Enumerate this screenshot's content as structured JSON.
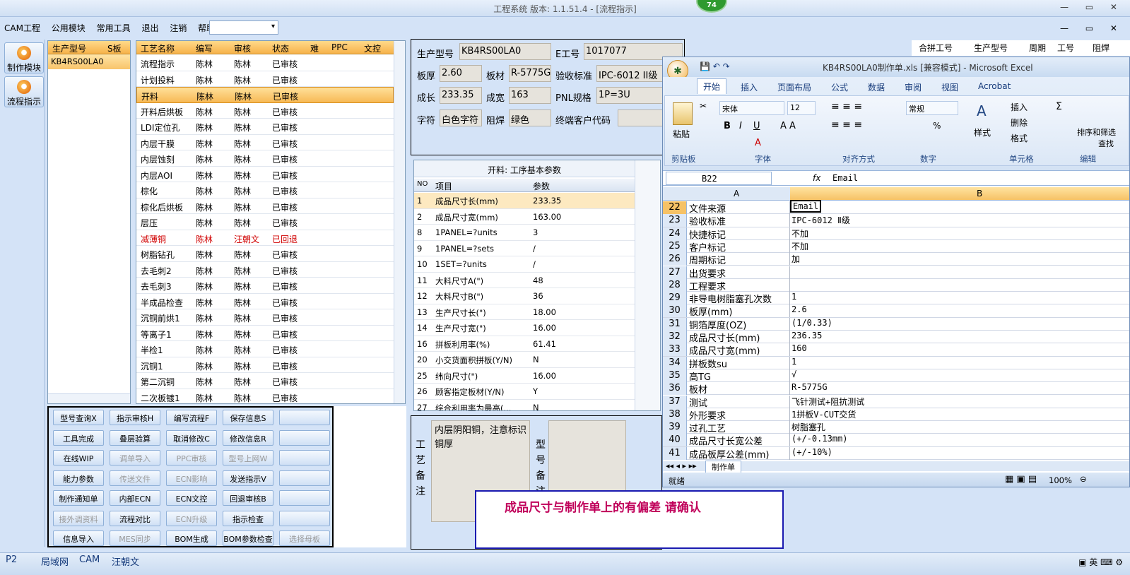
{
  "window": {
    "title": "工程系统   版本: 1.1.51.4 - [流程指示]",
    "badge": "74"
  },
  "menu": [
    "CAM工程",
    "公用模块",
    "常用工具",
    "退出",
    "注销",
    "帮助"
  ],
  "nav": [
    {
      "label": "制作模块"
    },
    {
      "label": "流程指示"
    }
  ],
  "prodlist": {
    "headers": [
      "生产型号",
      "S板"
    ],
    "rows": [
      "KB4RS00LA0"
    ]
  },
  "flow": {
    "headers": [
      "工艺名称",
      "编写",
      "审核",
      "状态",
      "难",
      "PPC",
      "文控"
    ],
    "rows": [
      {
        "name": "流程指示",
        "writer": "陈林",
        "reviewer": "陈林",
        "status": "已审核"
      },
      {
        "name": "计划投料",
        "writer": "陈林",
        "reviewer": "陈林",
        "status": "已审核"
      },
      {
        "name": "开料",
        "writer": "陈林",
        "reviewer": "陈林",
        "status": "已审核"
      },
      {
        "name": "开料后烘板",
        "writer": "陈林",
        "reviewer": "陈林",
        "status": "已审核"
      },
      {
        "name": "LDI定位孔",
        "writer": "陈林",
        "reviewer": "陈林",
        "status": "已审核"
      },
      {
        "name": "内层干膜",
        "writer": "陈林",
        "reviewer": "陈林",
        "status": "已审核"
      },
      {
        "name": "内层蚀刻",
        "writer": "陈林",
        "reviewer": "陈林",
        "status": "已审核"
      },
      {
        "name": "内层AOI",
        "writer": "陈林",
        "reviewer": "陈林",
        "status": "已审核"
      },
      {
        "name": "棕化",
        "writer": "陈林",
        "reviewer": "陈林",
        "status": "已审核"
      },
      {
        "name": "棕化后烘板",
        "writer": "陈林",
        "reviewer": "陈林",
        "status": "已审核"
      },
      {
        "name": "层压",
        "writer": "陈林",
        "reviewer": "陈林",
        "status": "已审核"
      },
      {
        "name": "减薄铜",
        "writer": "陈林",
        "reviewer": "汪朝文",
        "status": "已回退"
      },
      {
        "name": "树脂钻孔",
        "writer": "陈林",
        "reviewer": "陈林",
        "status": "已审核"
      },
      {
        "name": "去毛刺2",
        "writer": "陈林",
        "reviewer": "陈林",
        "status": "已审核"
      },
      {
        "name": "去毛刺3",
        "writer": "陈林",
        "reviewer": "陈林",
        "status": "已审核"
      },
      {
        "name": "半成品检查",
        "writer": "陈林",
        "reviewer": "陈林",
        "status": "已审核"
      },
      {
        "name": "沉铜前烘1",
        "writer": "陈林",
        "reviewer": "陈林",
        "status": "已审核"
      },
      {
        "name": "等离子1",
        "writer": "陈林",
        "reviewer": "陈林",
        "status": "已审核"
      },
      {
        "name": "半检1",
        "writer": "陈林",
        "reviewer": "陈林",
        "status": "已审核"
      },
      {
        "name": "沉铜1",
        "writer": "陈林",
        "reviewer": "陈林",
        "status": "已审核"
      },
      {
        "name": "第二沉铜",
        "writer": "陈林",
        "reviewer": "陈林",
        "status": "已审核"
      },
      {
        "name": "二次板镀1",
        "writer": "陈林",
        "reviewer": "陈林",
        "status": "已审核"
      }
    ]
  },
  "buttons": [
    [
      "型号查询X",
      "指示审核H",
      "编写流程F",
      "保存信息S",
      ""
    ],
    [
      "工具完成",
      "叠层验算",
      "取消修改C",
      "修改信息R",
      ""
    ],
    [
      "在线WIP",
      "调单导入",
      "PPC审核",
      "型号上网W",
      ""
    ],
    [
      "能力参数",
      "传送文件",
      "ECN影响",
      "发送指示V",
      ""
    ],
    [
      "制作通知单",
      "内部ECN",
      "ECN文控",
      "回退审核B",
      ""
    ],
    [
      "接外调资料",
      "流程对比",
      "ECN升级",
      "指示检查",
      ""
    ],
    [
      "信息导入",
      "MES同步",
      "BOM生成",
      "BOM参数检查",
      "选择母板"
    ]
  ],
  "info": {
    "prod_label": "生产型号",
    "prod": "KB4RS00LA0",
    "e_label": "E工号",
    "e": "1017077",
    "thick_label": "板厚",
    "thick": "2.60",
    "mat_label": "板材",
    "mat": "R-5775G",
    "std_label": "验收标准",
    "std": "IPC-6012 II级",
    "len_label": "成长",
    "len": "233.35",
    "wid_label": "成宽",
    "wid": "163",
    "pnl_label": "PNL规格",
    "pnl": "1P=3U",
    "char_label": "字符",
    "char": "白色字符",
    "mask_label": "阻焊",
    "mask": "绿色",
    "cust_label": "终端客户代码",
    "cust": ""
  },
  "params": {
    "title": "开料: 工序基本参数",
    "headers": [
      "NO",
      "项目",
      "参数"
    ],
    "rows": [
      {
        "no": "1",
        "item": "成品尺寸长(mm)",
        "val": "233.35"
      },
      {
        "no": "2",
        "item": "成品尺寸宽(mm)",
        "val": "163.00"
      },
      {
        "no": "8",
        "item": "1PANEL=?units",
        "val": "3"
      },
      {
        "no": "9",
        "item": "1PANEL=?sets",
        "val": "/"
      },
      {
        "no": "10",
        "item": "1SET=?units",
        "val": "/"
      },
      {
        "no": "11",
        "item": "大料尺寸A(\")",
        "val": "48"
      },
      {
        "no": "12",
        "item": "大料尺寸B(\")",
        "val": "36"
      },
      {
        "no": "13",
        "item": "生产尺寸长(\")",
        "val": "18.00"
      },
      {
        "no": "14",
        "item": "生产尺寸宽(\")",
        "val": "16.00"
      },
      {
        "no": "16",
        "item": "拼板利用率(%)",
        "val": "61.41"
      },
      {
        "no": "20",
        "item": "小交货面积拼板(Y/N)",
        "val": "N"
      },
      {
        "no": "25",
        "item": "纬向尺寸(\")",
        "val": "16.00"
      },
      {
        "no": "26",
        "item": "顾客指定板材(Y/N)",
        "val": "Y"
      },
      {
        "no": "27",
        "item": "综合利用率为最高(...",
        "val": "N"
      }
    ]
  },
  "remarks": {
    "craft_label": "工艺备注",
    "craft_text": "内层阴阳铜，注意标识铜厚",
    "model_label": "型号备注"
  },
  "rightlist": {
    "headers": [
      "合拼工号",
      "生产型号",
      "周期",
      "工号",
      "阻焊"
    ]
  },
  "excel": {
    "title": "KB4RS00LA0制作单.xls  [兼容模式] - Microsoft Excel",
    "tabs": [
      "开始",
      "插入",
      "页面布局",
      "公式",
      "数据",
      "审阅",
      "视图",
      "Acrobat"
    ],
    "font": "宋体",
    "size": "12",
    "numfmt": "常规",
    "groups": [
      "剪贴板",
      "字体",
      "对齐方式",
      "数字",
      "单元格",
      "编辑"
    ],
    "ribbon": {
      "paste": "粘贴",
      "style": "样式",
      "insert": "插入",
      "delete": "删除",
      "format": "格式",
      "sort": "排序和筛选",
      "find": "查找"
    },
    "cellref": "B22",
    "formula": "Email",
    "cols": [
      "A",
      "B"
    ],
    "rows": [
      {
        "n": "22",
        "a": "文件来源",
        "b": "Email"
      },
      {
        "n": "23",
        "a": "验收标准",
        "b": "IPC-6012 Ⅱ级"
      },
      {
        "n": "24",
        "a": "快捷标记",
        "b": "不加"
      },
      {
        "n": "25",
        "a": "客户标记",
        "b": "不加"
      },
      {
        "n": "26",
        "a": "周期标记",
        "b": "加"
      },
      {
        "n": "27",
        "a": "出货要求",
        "b": ""
      },
      {
        "n": "28",
        "a": "工程要求",
        "b": ""
      },
      {
        "n": "29",
        "a": "非导电树脂塞孔次数",
        "b": "1"
      },
      {
        "n": "30",
        "a": "板厚(mm)",
        "b": "2.6"
      },
      {
        "n": "31",
        "a": "铜箔厚度(OZ)",
        "b": " (1/0.33)"
      },
      {
        "n": "32",
        "a": "成品尺寸长(mm)",
        "b": "236.35"
      },
      {
        "n": "33",
        "a": "成品尺寸宽(mm)",
        "b": "160"
      },
      {
        "n": "34",
        "a": "拼板数su",
        "b": "1"
      },
      {
        "n": "35",
        "a": "高TG",
        "b": "√"
      },
      {
        "n": "36",
        "a": "板材",
        "b": "R-5775G"
      },
      {
        "n": "37",
        "a": "测试",
        "b": "飞针测试+阻抗测试"
      },
      {
        "n": "38",
        "a": "外形要求",
        "b": "1拼板V-CUT交货"
      },
      {
        "n": "39",
        "a": "过孔工艺",
        "b": "树脂塞孔"
      },
      {
        "n": "40",
        "a": "成品尺寸长宽公差",
        "b": "(+/-0.13mm)"
      },
      {
        "n": "41",
        "a": "成品板厚公差(mm)",
        "b": "(+/-10%)"
      }
    ],
    "sheet": "制作单",
    "status": "就绪",
    "zoom": "100%"
  },
  "notice": "成品尺寸与制作单上的有偏差   请确认",
  "statusbar": {
    "items": [
      "P2",
      "局域网",
      "CAM",
      "汪朝文"
    ]
  }
}
